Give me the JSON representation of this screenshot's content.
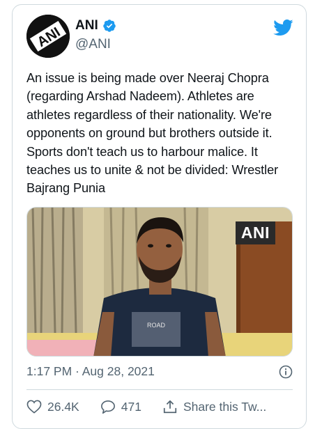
{
  "author": {
    "display_name": "ANI",
    "handle": "@ANI",
    "avatar_text": "ANI"
  },
  "tweet": {
    "text": "An issue is being made over Neeraj Chopra (regarding Arshad Nadeem). Athletes are athletes regardless of their nationality. We're opponents on ground but brothers outside it. Sports don't teach us to harbour malice. It teaches us to unite & not be divided: Wrestler Bajrang Punia",
    "timestamp": "1:17 PM · Aug 28, 2021"
  },
  "media": {
    "watermark": "ANI",
    "shirt_text": "ROAD"
  },
  "actions": {
    "likes": "26.4K",
    "replies": "471",
    "share_label": "Share this Tw..."
  },
  "colors": {
    "twitter_blue": "#1d9bf0",
    "text_primary": "#0f1419",
    "text_secondary": "#536471",
    "border": "#cfd9de"
  }
}
